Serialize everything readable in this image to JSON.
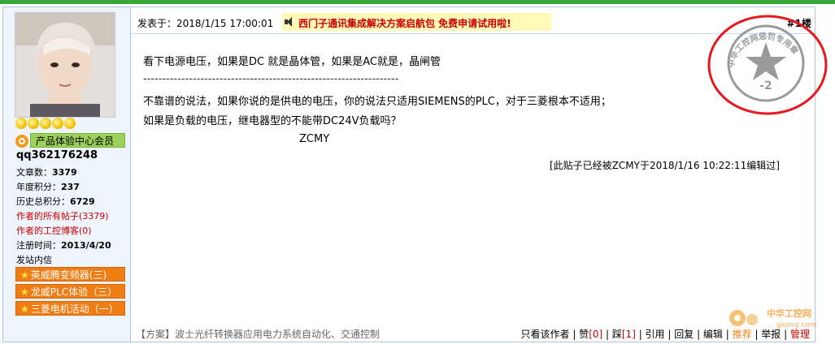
{
  "post": {
    "time_label": "发表于：",
    "time_value": "2018/1/15 17:00:01",
    "ad_text": "西门子通讯集成解决方案启航包 免费申请试用啦!",
    "floor": "#1楼",
    "lines": [
      "看下电源电压，如果是DC 就是晶体管，如果是AC就是，晶闸管",
      "-------------------------------------------------------------------",
      "不靠谱的说法，如果你说的是供电的电压，你的说法只适用SIEMENS的PLC，对于三菱根本不适用；",
      "如果是负载的电压，继电器型的不能带DC24V负载吗？",
      "ZCMY"
    ],
    "edit_note": "[此贴子已经被ZCMY于2018/1/16 10:22:11编辑过]",
    "footer_left": "【方案】波士光纤转换器应用电力系统自动化、交通控制",
    "actions": {
      "only_author": "只看该作者",
      "sep": " | ",
      "zan_label": "赞",
      "zan_count": "[0]",
      "cai_label": "踩",
      "cai_count": "[1]",
      "quote": "引用",
      "reply": "回复",
      "edit": "编辑",
      "recommend": "推荐",
      "report": "举报",
      "manage": "管理"
    }
  },
  "user": {
    "member_badge": "产品体验中心会员",
    "username": "qq362176248",
    "stats": [
      {
        "label": "文章数：",
        "value": "3379"
      },
      {
        "label": "年度积分：",
        "value": "237"
      },
      {
        "label": "历史总积分：",
        "value": "6729"
      }
    ],
    "all_posts_link": "作者的所有帖子",
    "all_posts_count": "(3379)",
    "blog_link": "作者的工控博客",
    "blog_count": "(0)",
    "register_label": "注册时间：",
    "register_value": "2013/4/20",
    "pm_label": "发站内信",
    "activities": [
      "英威腾变频器(三)",
      "龙威PLC体验（三）",
      "三菱电机活动（一）"
    ]
  },
  "stamp": {
    "text": "中华工控网惩罚专用章",
    "value": "-2"
  },
  "watermark": {
    "text": "中华工控网",
    "url": "gkong.com"
  },
  "colors": {
    "topbar": "#3aa53a",
    "stamp_red": "#e8161e",
    "activity_orange": "#f07d13",
    "link_red": "#cc0000"
  }
}
